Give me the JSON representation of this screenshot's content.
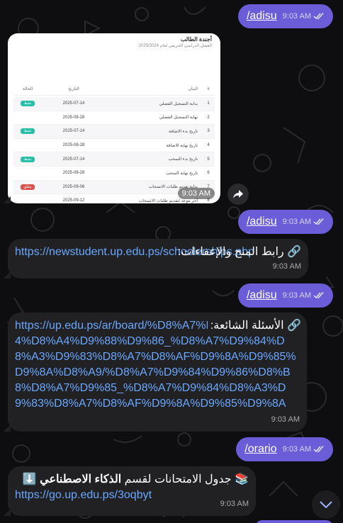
{
  "messages": {
    "m1": {
      "text": "/adisu",
      "time": "9:03 AM"
    },
    "photo": {
      "time": "9:03 AM",
      "doc_title": "أجندة الطالب",
      "doc_subtitle": "الفصل الدراسي الخريفي لعام 2025/2024",
      "headers": {
        "num": "#",
        "name": "البيان",
        "date": "التاريخ",
        "date2": "التاريخ",
        "status": "الحالة"
      },
      "rows": [
        {
          "num": "1",
          "name": "بداية التسجيل الفصلي",
          "date": "2025-07-14",
          "status": "نشط",
          "status_color": "green"
        },
        {
          "num": "2",
          "name": "نهاية التسجيل الفصلي",
          "date": "2025-08-28",
          "status": "",
          "status_color": ""
        },
        {
          "num": "3",
          "name": "تاريخ بدء الاضافة",
          "date": "2025-07-14",
          "status": "نشط",
          "status_color": "green"
        },
        {
          "num": "4",
          "name": "تاريخ نهاية الاضافة",
          "date": "2025-08-28",
          "status": "",
          "status_color": ""
        },
        {
          "num": "5",
          "name": "تاريخ بدء السحب",
          "date": "2025-07-14",
          "status": "نشط",
          "status_color": "green"
        },
        {
          "num": "6",
          "name": "تاريخ نهاية السحب",
          "date": "2025-08-28",
          "status": "",
          "status_color": ""
        },
        {
          "num": "7",
          "name": "بداية تقديم طلبات الانسحاب",
          "date": "2025-09-06",
          "status": "مغلق",
          "status_color": "red"
        },
        {
          "num": "8",
          "name": "آخر موعد لتقديم طلبات الانسحاب",
          "date": "2025-09-12",
          "status": "",
          "status_color": ""
        },
        {
          "num": "9",
          "name": "بداية تقديم طلبات الغير مكتمل",
          "date": "2025-09-24",
          "status": "مغلق",
          "status_color": "red"
        },
        {
          "num": "10",
          "name": "آخر موعد لتقديم طلبات الغير مكتمل",
          "date": "2025-09-30",
          "status": "",
          "status_color": ""
        }
      ]
    },
    "m2": {
      "text": "/adisu",
      "time": "9:03 AM"
    },
    "m3": {
      "icon": "🔗",
      "label": "رابط المنح والإعفاءات: ",
      "link": "https://newstudent.up.edu.ps/schoolerships.php",
      "time": "9:03 AM"
    },
    "m4": {
      "text": "/adisu",
      "time": "9:03 AM"
    },
    "m5": {
      "icon": "🔗",
      "label": "الأسئلة الشائعة: ",
      "link": "https://up.edu.ps/ar/board/%D8%A7%D9%84%D8%B4%D8%A4%D9%88%D9%86_%D8%A7%D9%84%D8%A3%D9%83%D8%A7%D8%AF%D9%8A%D9%85%D9%8A%D8%A9/%D8%A7%D9%84%D9%86%D8%B8%D8%A7%D9%85_%D8%A7%D9%84%D8%A3%D9%83%D8%A7%D8%AF%D9%8A%D9%85%D9%8A",
      "time": "9:03 AM"
    },
    "m6": {
      "text": "/orario",
      "time": "9:03 AM"
    },
    "m7": {
      "icon_left": "⬇️",
      "icon_right": "📚",
      "label_pre": "جدول الامتحانات لقسم ",
      "label_bold": "الذكاء الاصطناعي",
      "link": "https://go.up.edu.ps/3oqbyt",
      "time": "9:03 AM"
    }
  },
  "colors": {
    "outgoing": "#6b5cd8",
    "incoming": "#212124",
    "link": "#6aa8ff",
    "background": "#0e0e10"
  },
  "icons": {
    "read_receipt": "double-check-icon",
    "share": "share-icon",
    "scroll_down": "chevron-down-icon"
  }
}
